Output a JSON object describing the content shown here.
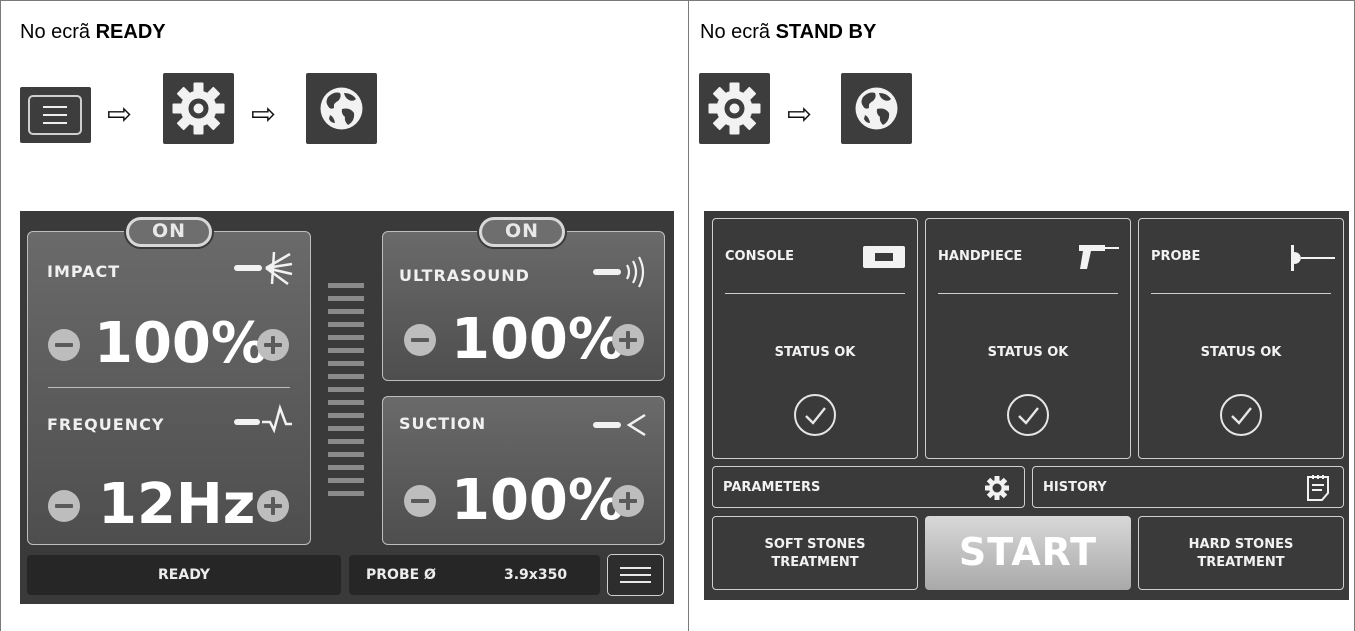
{
  "left": {
    "heading_prefix": "No ecrã",
    "heading_strong": "READY",
    "nav_icons": [
      "menu-icon",
      "gear-icon",
      "globe-icon"
    ],
    "arrow_glyph": "⇨",
    "screen": {
      "impact": {
        "toggle": "ON",
        "label": "IMPACT",
        "value": "100%"
      },
      "frequency": {
        "label": "FREQUENCY",
        "value": "12Hz"
      },
      "ultrasound": {
        "toggle": "ON",
        "label": "ULTRASOUND",
        "value": "100%"
      },
      "suction": {
        "label": "SUCTION",
        "value": "100%"
      },
      "status": "READY",
      "probe_label": "PROBE Ø",
      "probe_value": "3.9x350"
    }
  },
  "right": {
    "heading_prefix": "No ecrã",
    "heading_strong": "STAND BY",
    "nav_icons": [
      "gear-icon",
      "globe-icon"
    ],
    "arrow_glyph": "⇨",
    "screen": {
      "cards": [
        {
          "title": "CONSOLE",
          "status": "STATUS OK",
          "icon": "console-icon"
        },
        {
          "title": "HANDPIECE",
          "status": "STATUS OK",
          "icon": "handpiece-icon"
        },
        {
          "title": "PROBE",
          "status": "STATUS OK",
          "icon": "probe-icon"
        }
      ],
      "parameters_label": "PARAMETERS",
      "history_label": "HISTORY",
      "soft_line1": "SOFT STONES",
      "soft_line2": "TREATMENT",
      "start_label": "START",
      "hard_line1": "HARD STONES",
      "hard_line2": "TREATMENT"
    }
  },
  "colors": {
    "screen_bg": "#3a3a3a",
    "panel_border": "#bdbdbd",
    "text_light": "#f0f0f0",
    "start_gradient_top": "#d8d8d8"
  }
}
